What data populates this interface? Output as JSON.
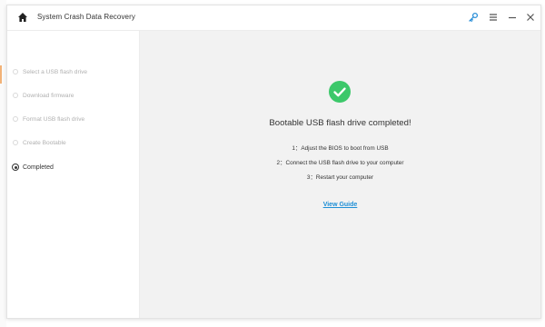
{
  "app": {
    "title": "System Crash Data Recovery"
  },
  "titlebar": {
    "icons": [
      "home-icon",
      "key-icon",
      "menu-icon",
      "minimize-icon",
      "close-icon"
    ]
  },
  "sidebar": {
    "steps": [
      {
        "label": "Select a USB flash drive",
        "state": "done"
      },
      {
        "label": "Download firmware",
        "state": "done"
      },
      {
        "label": "Format USB flash drive",
        "state": "done"
      },
      {
        "label": "Create Bootable",
        "state": "done"
      },
      {
        "label": "Completed",
        "state": "active"
      }
    ]
  },
  "main": {
    "heading": "Bootable USB flash drive completed!",
    "instructions": [
      "1：Adjust the BIOS to boot from USB",
      "2：Connect the USB flash drive to your computer",
      "3：Restart your computer"
    ],
    "link_label": "View Guide"
  },
  "colors": {
    "accent_blue": "#1e8fd6",
    "success_green": "#3cc86a",
    "main_bg": "#f2f2f2"
  }
}
